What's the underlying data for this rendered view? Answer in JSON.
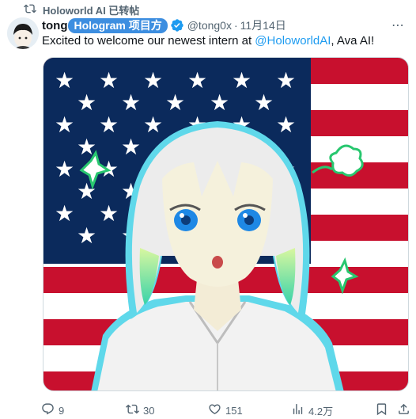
{
  "repost_bar": {
    "text": "Holoworld AI 已转帖"
  },
  "tweet": {
    "author_name": "tong",
    "author_badge": "Hologram 项目方",
    "handle": "@tong0x",
    "separator": "·",
    "date": "11月14日",
    "more_icon": "⋯",
    "text_before": "Excited to welcome our newest intern at ",
    "mention": "@HoloworldAI",
    "text_after": ", Ava AI!",
    "accent_color": "#1d9bf0",
    "badge_color": "#3d8ee0"
  },
  "media": {
    "icons": [
      "flag-background",
      "anime-girl-illustration"
    ]
  },
  "actions": {
    "replies": "9",
    "reposts": "30",
    "likes": "151",
    "views": "4.2万"
  }
}
